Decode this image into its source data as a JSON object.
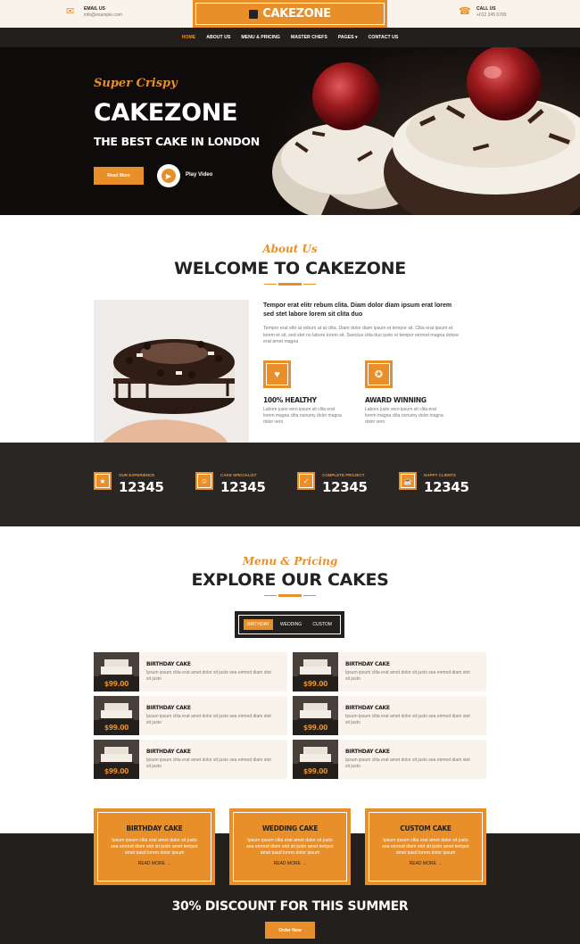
{
  "topbar": {
    "email": {
      "label": "EMAIL US",
      "value": "info@example.com",
      "icon": "envelope-icon"
    },
    "call": {
      "label": "CALL US",
      "value": "+012 345 6789",
      "icon": "phone-icon"
    },
    "logo": "CAKEZONE"
  },
  "nav": {
    "items": [
      "HOME",
      "ABOUT US",
      "MENU & PRICING",
      "MASTER CHEFS",
      "PAGES ▾",
      "CONTACT US"
    ],
    "active": 0
  },
  "hero": {
    "subtitle": "Super Crispy",
    "title": "CAKEZONE",
    "tagline": "THE BEST CAKE IN LONDON",
    "button": "Read More",
    "play_label": "Play Video"
  },
  "about": {
    "subtitle": "About Us",
    "title": "WELCOME TO CAKEZONE",
    "lead": "Tempor erat elitr rebum clita. Diam dolor diam ipsum erat lorem sed stet labore lorem sit clita duo",
    "body": "Tempor erat elitr at rebum at at clita. Diam dolor diam ipsum et tempor sit. Clita erat ipsum et lorem et sit, sed stet no labore lorem sit. Sanctus clita duo justo et tempor eirmod magna dolore erat amet magna",
    "features": [
      {
        "title": "100% HEALTHY",
        "desc": "Labore justo vero ipsum sit clita erat lorem magna clita nonumy dolor magna dolor vero",
        "icon": "heart-icon"
      },
      {
        "title": "AWARD WINNING",
        "desc": "Labore justo vero ipsum sit clita erat lorem magna clita nonumy dolor magna dolor vero",
        "icon": "award-icon"
      }
    ]
  },
  "stats": [
    {
      "label": "OUR EXPERIENCE",
      "value": "12345",
      "icon": "star-icon"
    },
    {
      "label": "CAKE SPECIALIST",
      "value": "12345",
      "icon": "users-icon"
    },
    {
      "label": "COMPLETE PROJECT",
      "value": "12345",
      "icon": "check-icon"
    },
    {
      "label": "HAPPY CLIENTS",
      "value": "12345",
      "icon": "mug-icon"
    }
  ],
  "menu": {
    "subtitle": "Menu & Pricing",
    "title": "EXPLORE OUR CAKES",
    "tabs": [
      "BIRTHDAY",
      "WEDDING",
      "CUSTOM"
    ],
    "active_tab": 0,
    "items": [
      {
        "name": "BIRTHDAY CAKE",
        "desc": "Ipsum ipsum clita erat amet dolor sit justo sea eirmod diam stet sit justo",
        "price": "$99.00"
      },
      {
        "name": "BIRTHDAY CAKE",
        "desc": "Ipsum ipsum clita erat amet dolor sit justo sea eirmod diam stet sit justo",
        "price": "$99.00"
      },
      {
        "name": "BIRTHDAY CAKE",
        "desc": "Ipsum ipsum clita erat amet dolor sit justo sea eirmod diam stet sit justo",
        "price": "$99.00"
      },
      {
        "name": "BIRTHDAY CAKE",
        "desc": "Ipsum ipsum clita erat amet dolor sit justo sea eirmod diam stet sit justo",
        "price": "$99.00"
      },
      {
        "name": "BIRTHDAY CAKE",
        "desc": "Ipsum ipsum clita erat amet dolor sit justo sea eirmod diam stet sit justo",
        "price": "$99.00"
      },
      {
        "name": "BIRTHDAY CAKE",
        "desc": "Ipsum ipsum clita erat amet dolor sit justo sea eirmod diam stet sit justo",
        "price": "$99.00"
      }
    ]
  },
  "offer": {
    "cards": [
      {
        "title": "BIRTHDAY CAKE",
        "desc": "Ipsum ipsum clita erat amet dolor sit justo sea eirmod diam stet sit justo amet tempor amet kasd lorem dolor ipsum",
        "link": "READ MORE →"
      },
      {
        "title": "WEDDING CAKE",
        "desc": "Ipsum ipsum clita erat amet dolor sit justo sea eirmod diam stet sit justo amet tempor amet kasd lorem dolor ipsum",
        "link": "READ MORE →"
      },
      {
        "title": "CUSTOM CAKE",
        "desc": "Ipsum ipsum clita erat amet dolor sit justo sea eirmod diam stet sit justo amet tempor amet kasd lorem dolor ipsum",
        "link": "READ MORE →"
      }
    ],
    "discount": "30% DISCOUNT FOR THIS SUMMER",
    "button": "Order Now"
  },
  "colors": {
    "accent": "#e88f2a",
    "dark": "#221f1d",
    "cream": "#faf3eb"
  }
}
